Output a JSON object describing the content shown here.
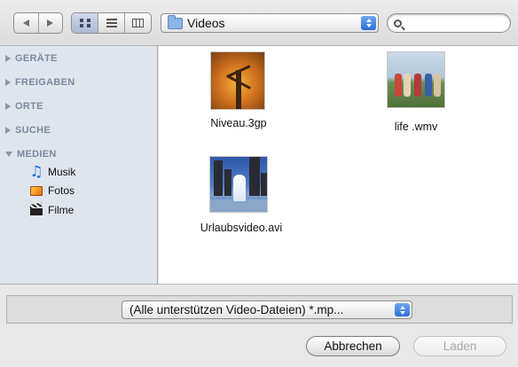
{
  "toolbar": {
    "back_icon": "back-arrow-icon",
    "forward_icon": "forward-arrow-icon",
    "view_modes": [
      {
        "icon": "icon-view-icon",
        "active": true
      },
      {
        "icon": "list-view-icon",
        "active": false
      },
      {
        "icon": "column-view-icon",
        "active": false
      }
    ],
    "location": "Videos",
    "search_placeholder": ""
  },
  "sidebar": {
    "sections": [
      "GERÄTE",
      "FREIGABEN",
      "ORTE",
      "SUCHE",
      "MEDIEN"
    ],
    "media_items": [
      {
        "label": "Musik",
        "icon": "music-icon"
      },
      {
        "label": "Fotos",
        "icon": "photos-icon"
      },
      {
        "label": "Filme",
        "icon": "movies-icon"
      }
    ]
  },
  "files": [
    {
      "name": "Niveau.3gp",
      "thumbnail": "autumn-tree"
    },
    {
      "name": "life .wmv",
      "thumbnail": "people-outdoors"
    },
    {
      "name": "Urlaubsvideo.avi",
      "thumbnail": "city-fountain"
    }
  ],
  "footer": {
    "file_type_filter": "(Alle unterstützen Video-Dateien) *.mp...",
    "cancel_label": "Abbrechen",
    "load_label": "Laden"
  },
  "colors": {
    "sidebar_bg": "#dfe5ed",
    "accent_blue": "#2a6fd6",
    "section_text": "#7c8a9c"
  }
}
